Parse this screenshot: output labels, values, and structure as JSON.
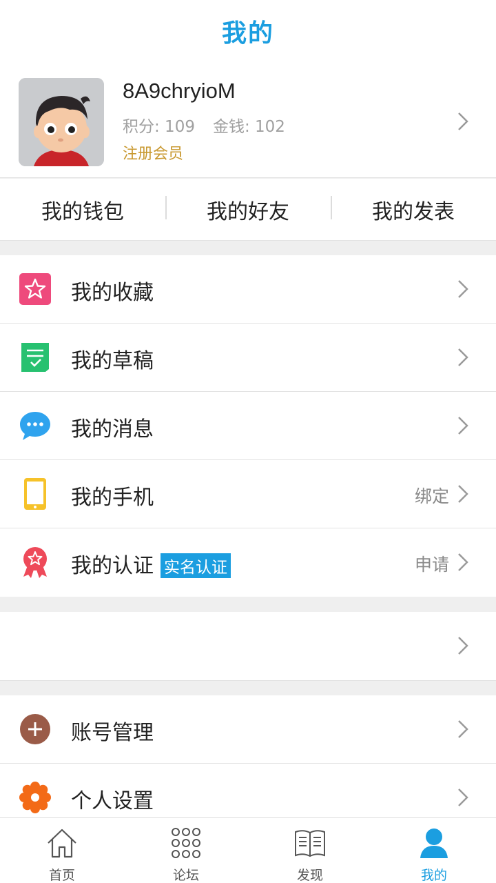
{
  "header": {
    "title": "我的"
  },
  "profile": {
    "username": "8A9chryioM",
    "points_label": "积分: 109",
    "money_label": "金钱: 102",
    "member_level": "注册会员"
  },
  "quick_links": [
    {
      "label": "我的钱包"
    },
    {
      "label": "我的好友"
    },
    {
      "label": "我的发表"
    }
  ],
  "menu_group1": [
    {
      "label": "我的收藏",
      "icon": "star-icon",
      "color": "#ee4a7c"
    },
    {
      "label": "我的草稿",
      "icon": "draft-icon",
      "color": "#27c170"
    },
    {
      "label": "我的消息",
      "icon": "chat-bubble-icon",
      "color": "#2fa3ee"
    },
    {
      "label": "我的手机",
      "icon": "phone-icon",
      "color": "#f6c22a",
      "right": "绑定"
    },
    {
      "label": "我的认证",
      "icon": "badge-icon",
      "color": "#ee4a5a",
      "tag": "实名认证",
      "right": "申请"
    }
  ],
  "menu_group3": [
    {
      "label": "账号管理",
      "icon": "plus-circle-icon",
      "color": "#9a5b48"
    },
    {
      "label": "个人设置",
      "icon": "flower-gear-icon",
      "color": "#f36a17"
    }
  ],
  "tabbar": [
    {
      "label": "首页",
      "icon": "home-icon"
    },
    {
      "label": "论坛",
      "icon": "grid-dots-icon"
    },
    {
      "label": "发现",
      "icon": "book-icon"
    },
    {
      "label": "我的",
      "icon": "user-icon",
      "active": true
    }
  ],
  "colors": {
    "accent": "#1b9ee0",
    "member": "#c8982f"
  }
}
